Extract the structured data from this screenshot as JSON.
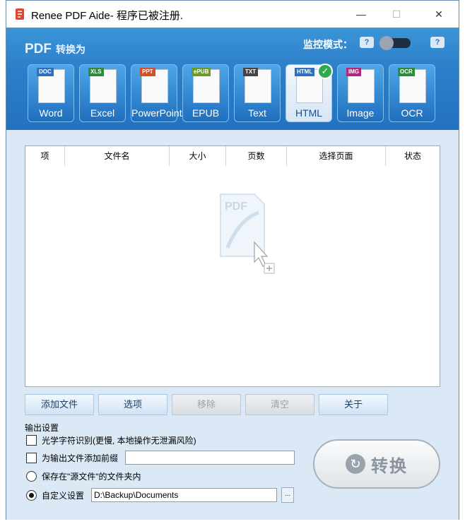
{
  "window": {
    "title": "Renee PDF Aide- 程序已被注册.",
    "minimize": "—",
    "maximize": "☐",
    "close": "✕"
  },
  "header": {
    "pdf_label": "PDF",
    "pdf_sub": "转换为",
    "monitor_label": "监控模式：",
    "help": "?"
  },
  "tools": [
    {
      "label": "Word",
      "tag": "DOC",
      "tag_color": "#2f6fc2"
    },
    {
      "label": "Excel",
      "tag": "XLS",
      "tag_color": "#2e8a3e"
    },
    {
      "label": "PowerPoint",
      "tag": "PPT",
      "tag_color": "#d2502a"
    },
    {
      "label": "EPUB",
      "tag": "ePUB",
      "tag_color": "#6a9a2a"
    },
    {
      "label": "Text",
      "tag": "TXT",
      "tag_color": "#444444"
    },
    {
      "label": "HTML",
      "tag": "HTML",
      "tag_color": "#2f6fc2",
      "selected": true
    },
    {
      "label": "Image",
      "tag": "IMG",
      "tag_color": "#b0287a"
    },
    {
      "label": "OCR",
      "tag": "OCR",
      "tag_color": "#2e8a3e"
    }
  ],
  "table": {
    "headers": [
      "项",
      "文件名",
      "大小",
      "页数",
      "选择页面",
      "状态"
    ]
  },
  "buttons": {
    "add_file": "添加文件",
    "options": "选项",
    "remove": "移除",
    "clear": "清空",
    "about": "关于"
  },
  "output": {
    "title": "输出设置",
    "ocr_label": "光学字符识别(更慢, 本地操作无泄漏风险)",
    "prefix_label": "为输出文件添加前缀",
    "prefix_value": "",
    "source_folder_label": "保存在\"源文件\"的文件夹内",
    "custom_label": "自定义设置",
    "custom_path": "D:\\Backup\\Documents",
    "browse": "..."
  },
  "convert": {
    "label": "转换"
  },
  "colors": {
    "header_blue": "#2c7fc9",
    "panel_bg": "#dbe9f6",
    "check_green": "#2fa84f"
  }
}
